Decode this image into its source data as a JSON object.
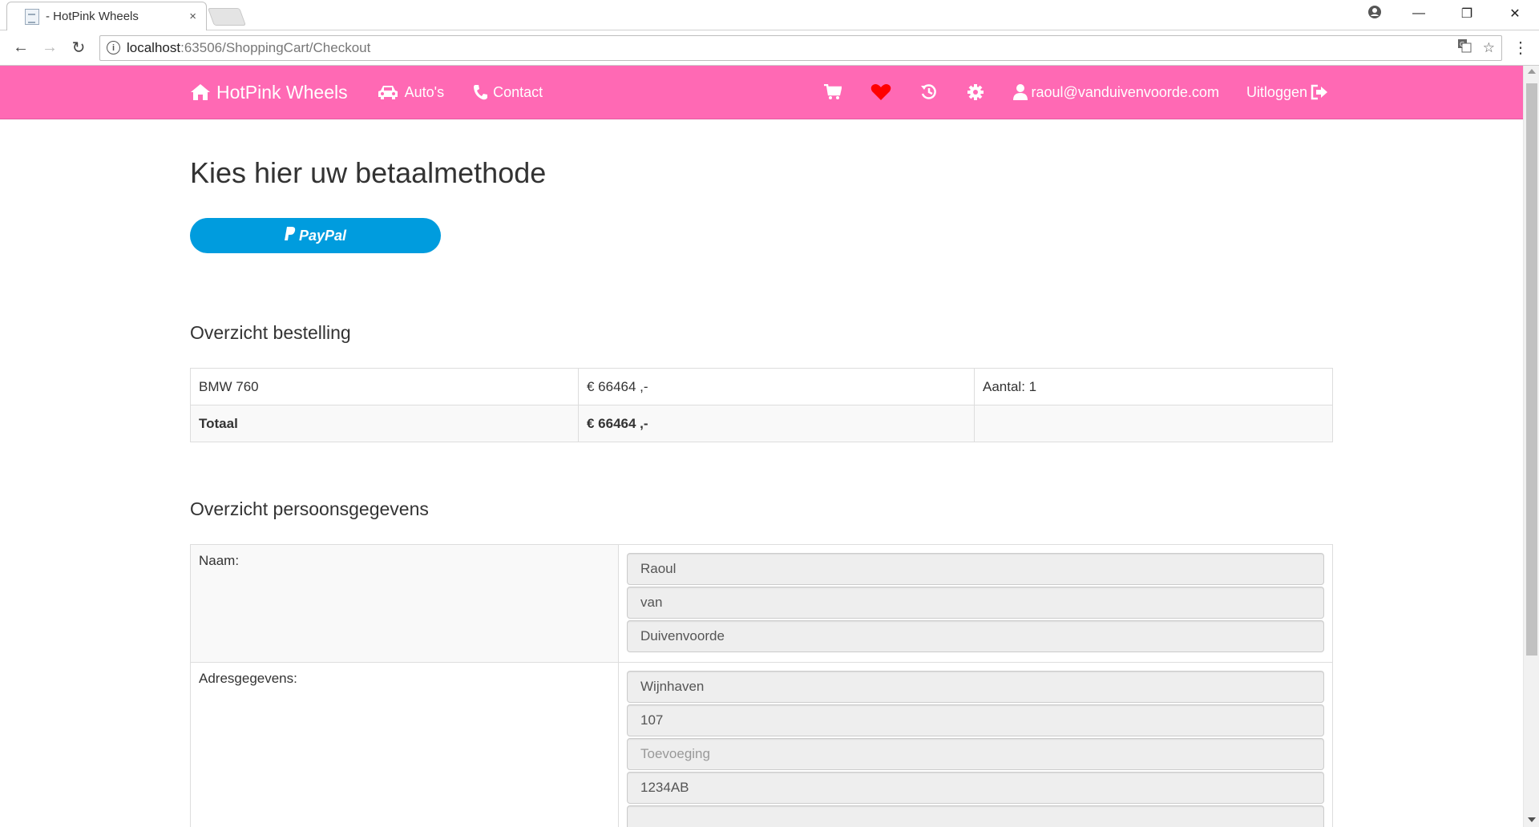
{
  "browser": {
    "tab_title": "- HotPink Wheels",
    "tab_close": "×",
    "url_host": "localhost",
    "url_path": ":63506/ShoppingCart/Checkout"
  },
  "nav": {
    "brand": "HotPink Wheels",
    "links": [
      "Auto's",
      "Contact"
    ],
    "user_email": "raoul@vanduivenvoorde.com",
    "logout": "Uitloggen"
  },
  "page": {
    "title": "Kies hier uw betaalmethode",
    "paypal_label": "PayPal",
    "order_heading": "Overzicht bestelling",
    "person_heading": "Overzicht persoonsgegevens"
  },
  "order": {
    "rows": [
      {
        "product": "BMW 760",
        "price": "€ 66464 ,-",
        "qty": "Aantal: 1"
      }
    ],
    "total_label": "Totaal",
    "total_price": "€ 66464 ,-"
  },
  "person": {
    "name_label": "Naam:",
    "first_name": "Raoul",
    "infix": "van",
    "last_name": "Duivenvoorde",
    "address_label": "Adresgegevens:",
    "street": "Wijnhaven",
    "house_number": "107",
    "addition_placeholder": "Toevoeging",
    "postal_code": "1234AB"
  },
  "colors": {
    "nav_bg": "#ff69b4",
    "paypal": "#009cde",
    "heart": "#ff0000"
  }
}
